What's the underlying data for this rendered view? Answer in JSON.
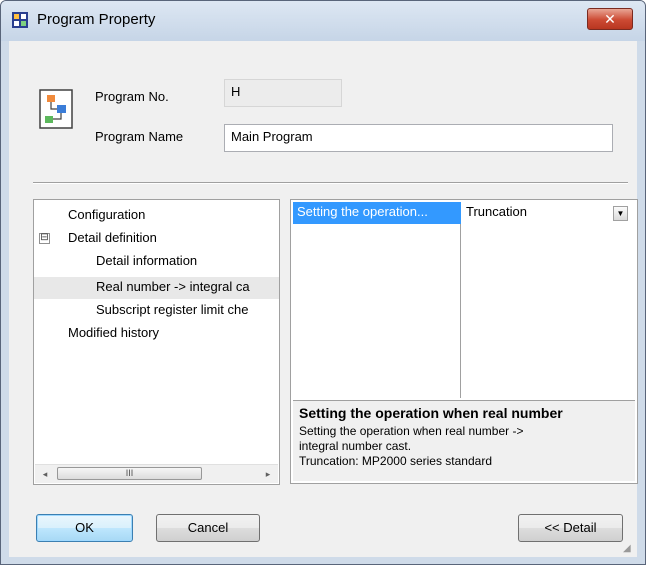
{
  "window": {
    "title": "Program Property",
    "close_label": "✕"
  },
  "program": {
    "no_label": "Program No.",
    "no_value": "H",
    "name_label": "Program Name",
    "name_value": "Main Program"
  },
  "tree": {
    "items": [
      {
        "label": "Configuration"
      },
      {
        "label": "Detail definition",
        "expander": "⊟"
      },
      {
        "label": "Detail information"
      },
      {
        "label": "Real number -> integral ca"
      },
      {
        "label": "Subscript register limit che"
      },
      {
        "label": "Modified history"
      }
    ],
    "scroll_left": "◂",
    "scroll_right": "▸",
    "scroll_thumb": "III"
  },
  "property_grid": {
    "name": "Setting the operation...",
    "value": "Truncation",
    "dropdown_glyph": "▼",
    "description_title": "Setting the operation when real number",
    "description_lines": [
      "Setting the operation when real number ->",
      "integral number cast.",
      "Truncation: MP2000 series standard"
    ]
  },
  "buttons": {
    "ok": "OK",
    "cancel": "Cancel",
    "detail": "<< Detail"
  },
  "colors": {
    "selection": "#3399ff",
    "titlebar": "#c6d5e7",
    "close_button": "#cc4a33"
  }
}
